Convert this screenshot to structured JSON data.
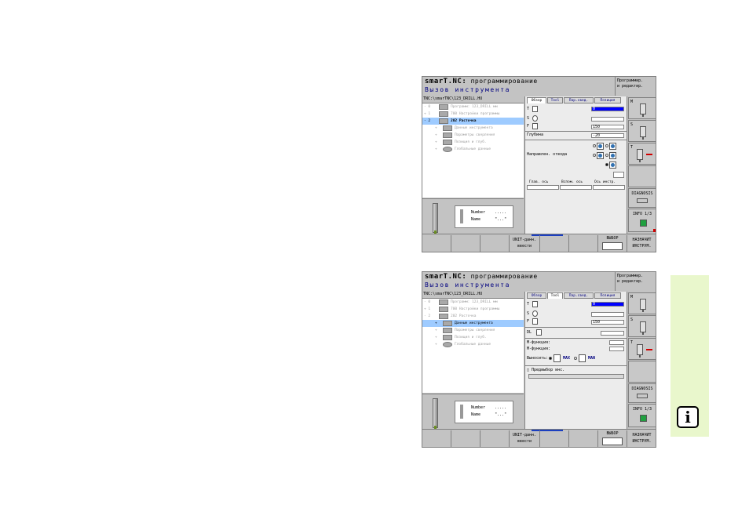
{
  "screens": [
    {
      "header_line1_prefix": "smarT.NC:",
      "header_line1_rest": "программирование",
      "header_line2": "Вызов инструмента",
      "mode": "Программир.\nи редактир.",
      "path": "TNC:\\smarTNC\\123_DRILL.HU",
      "tree": [
        {
          "marker": "- 0",
          "text": "Программ: 123_DRILL мм",
          "active": false,
          "selected": false
        },
        {
          "marker": "+ 1",
          "text": "700 Настройки программы",
          "active": false,
          "selected": false
        },
        {
          "marker": "- 2",
          "text": "202 Расточка",
          "active": true,
          "selected": true
        },
        {
          "marker": "+",
          "text": "Данные инструмента",
          "active": false,
          "selected": false
        },
        {
          "marker": "+",
          "text": "Параметры сверления",
          "active": false,
          "selected": false
        },
        {
          "marker": "+",
          "text": "Позиция и глуб.",
          "active": false,
          "selected": false
        },
        {
          "marker": "+",
          "text": "Глобальные данные",
          "active": false,
          "selected": false
        }
      ],
      "preview": {
        "number_label": "Number",
        "number_value": ".....",
        "name_label": "Name",
        "name_value": "\"...\""
      },
      "tabs": [
        "Обзор",
        "Tool",
        "Пар.свед.",
        "Позиция"
      ],
      "active_tab": 0,
      "form": {
        "t_label": "T",
        "t_value": "0",
        "s_label": "S",
        "s_value": "",
        "f_label": "F",
        "f_value": "150",
        "depth_label": "Глубина",
        "depth_value": "-20",
        "dir_label": "Направлен. отвода"
      },
      "table_headers": [
        "Глав. ось",
        "Вспом. ось",
        "Ось инстр."
      ],
      "side_buttons": [
        {
          "label": "M",
          "icon": "spindle-m-icon"
        },
        {
          "label": "S",
          "icon": "spindle-s-icon"
        },
        {
          "label": "T",
          "icon": "tool-change-icon"
        },
        {
          "label": "",
          "icon": ""
        },
        {
          "label": "DIAGNOSIS",
          "icon": "diagnosis-icon"
        },
        {
          "label": "INFO 1/3",
          "icon": "info-icon"
        }
      ],
      "softkeys": [
        "",
        "",
        "",
        "UNIT-данн.\nввести",
        "",
        "",
        "ВЫБОР",
        "НАЗНАЧИТ\nИНСТРУМ."
      ]
    },
    {
      "header_line1_prefix": "smarT.NC:",
      "header_line1_rest": "программирование",
      "header_line2": "Вызов инструмента",
      "mode": "Программир.\nи редактир.",
      "path": "TNC:\\smarTNC\\123_DRILL.HU",
      "tree": [
        {
          "marker": "- 0",
          "text": "Программ: 123_DRILL мм",
          "active": false,
          "selected": false
        },
        {
          "marker": "+ 1",
          "text": "700 Настройки программы",
          "active": false,
          "selected": false
        },
        {
          "marker": "- 2",
          "text": "202 Расточка",
          "active": false,
          "selected": false
        },
        {
          "marker": "+",
          "text": "Данные инструмента",
          "active": true,
          "selected": true
        },
        {
          "marker": "+",
          "text": "Параметры сверления",
          "active": false,
          "selected": false
        },
        {
          "marker": "+",
          "text": "Позиция и глуб.",
          "active": false,
          "selected": false
        },
        {
          "marker": "+",
          "text": "Глобальные данные",
          "active": false,
          "selected": false
        }
      ],
      "preview": {
        "number_label": "Number",
        "number_value": ".....",
        "name_label": "Name",
        "name_value": "\"...\""
      },
      "tabs": [
        "Обзор",
        "Tool",
        "Пар.свед.",
        "Позиция"
      ],
      "active_tab": 1,
      "form": {
        "t_label": "T",
        "t_value": "0",
        "s_label": "S",
        "s_value": "",
        "f_label": "F",
        "f_value": "150",
        "dl_label": "DL",
        "dl_value": "",
        "m_func1_label": "М-функция:",
        "m_func2_label": "М-функция:",
        "lift_label": "Выносить:",
        "max_label": "MAX",
        "man_label": "MAN",
        "preset_label": "Предвыбор инс."
      },
      "side_buttons": [
        {
          "label": "M",
          "icon": "spindle-m-icon"
        },
        {
          "label": "S",
          "icon": "spindle-s-icon"
        },
        {
          "label": "T",
          "icon": "tool-change-icon"
        },
        {
          "label": "",
          "icon": ""
        },
        {
          "label": "DIAGNOSIS",
          "icon": "diagnosis-icon"
        },
        {
          "label": "INFO 1/3",
          "icon": "info-icon"
        }
      ],
      "softkeys": [
        "",
        "",
        "",
        "UNIT-данн.\nввести",
        "",
        "",
        "ВЫБОР",
        "НАЗНАЧИТ\nИНСТРУМ."
      ]
    }
  ],
  "info_symbol": "i",
  "colors": {
    "info_bar": "#e9f7cc",
    "selection": "#9ecbff",
    "highlight_field": "#0000ff"
  }
}
